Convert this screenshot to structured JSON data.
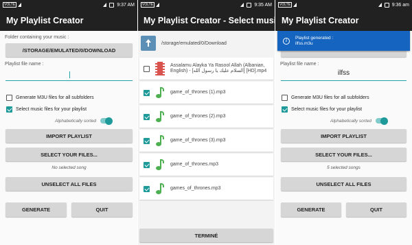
{
  "screen1": {
    "status_time": "9:37 AM",
    "status_volte": "VOLTE",
    "title": "My Playlist Creator",
    "folder_label": "Folder containing your music :",
    "folder_button": "/STORAGE/EMULATED/0/DOWNLOAD",
    "playlist_label": "Playlist file name :",
    "playlist_value": "",
    "m3u_checkbox": "Generate M3U files for all subfolders",
    "select_checkbox": "Select music files for your playlist",
    "sort_label": "Alphabetically sorted",
    "import_button": "IMPORT PLAYLIST",
    "select_files_button": "SELECT YOUR FILES...",
    "selection_info": "No selected song",
    "unselect_button": "UNSELECT ALL FILES",
    "generate_button": "GENERATE",
    "quit_button": "QUIT"
  },
  "screen2": {
    "status_time": "9:35 AM",
    "status_volte": "VOLTE",
    "title": "My Playlist Creator - Select music...",
    "path": "/storage/emulated/0/Download",
    "files": [
      {
        "name": "Assalamu Alayka Ya Rasool Allah (Albanian, English) - [السلام عليك يا رسول الله] [HD].mp4",
        "checked": false,
        "type": "video"
      },
      {
        "name": "game_of_thrones (1).mp3",
        "checked": true,
        "type": "audio"
      },
      {
        "name": "game_of_thrones (2).mp3",
        "checked": true,
        "type": "audio"
      },
      {
        "name": "game_of_thrones (3).mp3",
        "checked": true,
        "type": "audio"
      },
      {
        "name": "game_of_thrones.mp3",
        "checked": true,
        "type": "audio"
      },
      {
        "name": "games_of_thrones.mp3",
        "checked": true,
        "type": "audio"
      }
    ],
    "done_button": "TERMINÉ"
  },
  "screen3": {
    "status_time": "9:36 am",
    "status_volte": "VOLTE",
    "title": "My Playlist Creator",
    "toast_line1": "Playlist generated :",
    "toast_line2": "ilfss.m3u",
    "playlist_label": "Playlist file name :",
    "playlist_value": "ilfss",
    "m3u_checkbox": "Generate M3U files for all subfolders",
    "select_checkbox": "Select music files for your playlist",
    "sort_label": "Alphabetically sorted",
    "import_button": "IMPORT PLAYLIST",
    "select_files_button": "SELECT YOUR FILES...",
    "selection_info": "5 selected songs",
    "unselect_button": "UNSELECT ALL FILES",
    "generate_button": "GENERATE",
    "quit_button": "QUIT"
  },
  "colors": {
    "appbar": "#212121",
    "accent": "#1f9a9a",
    "button": "#d6d6d6",
    "toast": "#1565c0",
    "music_icon": "#4caf50"
  }
}
